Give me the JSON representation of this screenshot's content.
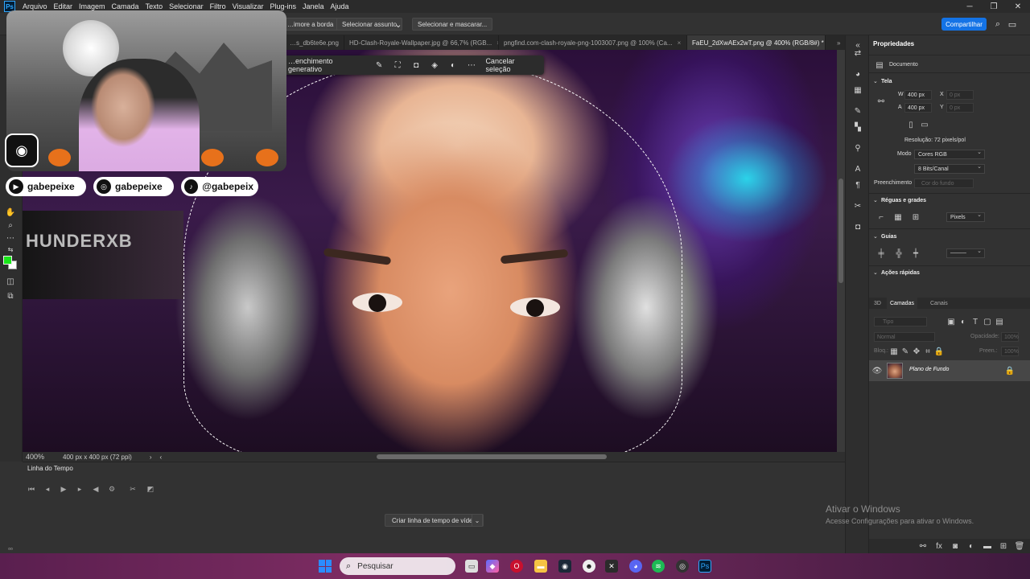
{
  "menubar": {
    "logo": "Ps",
    "items": [
      "Arquivo",
      "Editar",
      "Imagem",
      "Camada",
      "Texto",
      "Selecionar",
      "Filtro",
      "Visualizar",
      "Plug-ins",
      "Janela",
      "Ajuda"
    ]
  },
  "options": {
    "btn1": "…imore a borda",
    "btn2": "Selecionar assunto",
    "btn3": "Selecionar e mascarar...",
    "share": "Compartilhar"
  },
  "tabs": [
    {
      "label": "…s_db6te6e.png",
      "close": "×"
    },
    {
      "label": "HD-Clash-Royale-Wallpaper.jpg @ 66,7% (RGB...",
      "close": "×"
    },
    {
      "label": "pngfind.com-clash-royale-png-1003007.png @ 100% (Ca...",
      "close": "×"
    },
    {
      "label": "FaEU_2dXwAEx2wT.png @ 400% (RGB/8#) *",
      "close": "×"
    }
  ],
  "context_bar": {
    "label": "…enchimento generativo",
    "cancel": "Cancelar seleção"
  },
  "overlay": {
    "socials": [
      "gabepeixe",
      "gabepeixe",
      "@gabepeix"
    ]
  },
  "canvas": {
    "hat_text": "HUNDERXB"
  },
  "status": {
    "zoom": "400%",
    "doc_info": "400 px x 400 px (72 ppi)"
  },
  "timeline": {
    "title": "Linha do Tempo",
    "create": "Criar linha de tempo de vídeo"
  },
  "properties": {
    "title": "Propriedades",
    "doc": "Documento",
    "canvas_section": "Tela",
    "w_label": "W",
    "w_value": "400 px",
    "x_label": "X",
    "x_value": "0 px",
    "h_label": "A",
    "h_value": "400 px",
    "y_label": "Y",
    "y_value": "0 px",
    "resolution": "Resolução: 72 pixels/pol",
    "mode_label": "Modo",
    "mode_value": "Cores RGB",
    "depth_value": "8 Bits/Canal",
    "fill_label": "Preenchimento",
    "fill_value": "Cor do fundo",
    "rulers_section": "Réguas e grades",
    "units_value": "Pixels",
    "guides_section": "Guias",
    "quick_actions": "Ações rápidas"
  },
  "layers": {
    "tabs": [
      "3D",
      "Camadas",
      "Canais"
    ],
    "search": "Tipo",
    "blend": "Normal",
    "opacity_label": "Opacidade:",
    "opacity_value": "100%",
    "lock_label": "Bloq.:",
    "fill_label": "Preen.:",
    "fill_value": "100%",
    "layer_name": "Plano de Fundo"
  },
  "activate_windows": {
    "title": "Ativar o Windows",
    "subtitle": "Acesse Configurações para ativar o Windows."
  },
  "taskbar": {
    "search_placeholder": "Pesquisar"
  },
  "colors": {
    "foreground": "#19e619",
    "background": "#ffffff",
    "accent": "#1473e6"
  }
}
